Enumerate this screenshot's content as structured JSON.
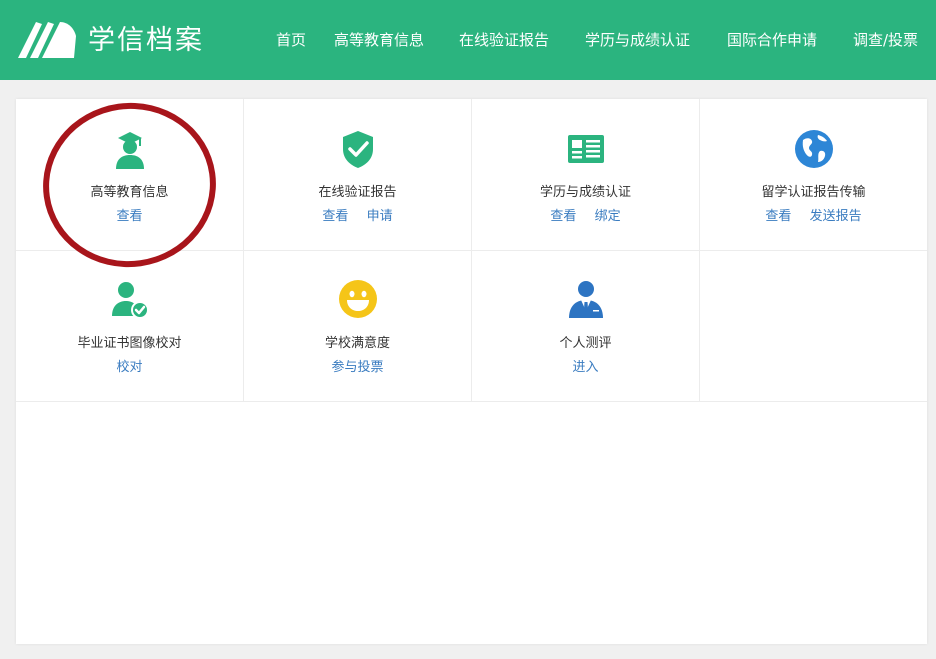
{
  "header": {
    "brand": "学信档案",
    "nav": [
      "首页",
      "高等教育信息",
      "在线验证报告",
      "学历与成绩认证",
      "国际合作申请",
      "调查/投票"
    ]
  },
  "tiles": [
    {
      "title": "高等教育信息",
      "links": [
        "查看"
      ],
      "icon": "graduate-icon"
    },
    {
      "title": "在线验证报告",
      "links": [
        "查看",
        "申请"
      ],
      "icon": "shield-check-icon"
    },
    {
      "title": "学历与成绩认证",
      "links": [
        "查看",
        "绑定"
      ],
      "icon": "certificate-icon"
    },
    {
      "title": "留学认证报告传输",
      "links": [
        "查看",
        "发送报告"
      ],
      "icon": "globe-icon"
    },
    {
      "title": "毕业证书图像校对",
      "links": [
        "校对"
      ],
      "icon": "user-check-icon"
    },
    {
      "title": "学校满意度",
      "links": [
        "参与投票"
      ],
      "icon": "smiley-icon"
    },
    {
      "title": "个人测评",
      "links": [
        "进入"
      ],
      "icon": "person-tie-icon"
    }
  ],
  "colors": {
    "header_bg": "#2bb47f",
    "tile_icon_green": "#2bb47f",
    "globe_blue": "#2d86d6",
    "smiley_yellow": "#f5c518",
    "person_blue": "#2d74c2",
    "link": "#3a7cc0",
    "annotation_red": "#a8151b"
  }
}
